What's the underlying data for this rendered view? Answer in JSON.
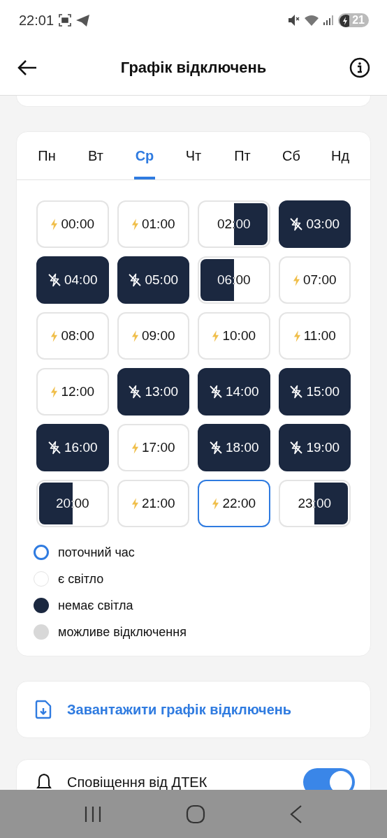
{
  "status_bar": {
    "time": "22:01",
    "battery": "21"
  },
  "app_bar": {
    "title": "Графік відключень"
  },
  "days": [
    {
      "label": "Пн",
      "selected": false
    },
    {
      "label": "Вт",
      "selected": false
    },
    {
      "label": "Ср",
      "selected": true
    },
    {
      "label": "Чт",
      "selected": false
    },
    {
      "label": "Пт",
      "selected": false
    },
    {
      "label": "Сб",
      "selected": false
    },
    {
      "label": "Нд",
      "selected": false
    }
  ],
  "hours": [
    {
      "time": "00:00",
      "kind": "on",
      "current": false
    },
    {
      "time": "01:00",
      "kind": "on",
      "current": false
    },
    {
      "time": "02:00",
      "kind": "late",
      "current": false
    },
    {
      "time": "03:00",
      "kind": "off",
      "current": false
    },
    {
      "time": "04:00",
      "kind": "off",
      "current": false
    },
    {
      "time": "05:00",
      "kind": "off",
      "current": false
    },
    {
      "time": "06:00",
      "kind": "early",
      "current": false
    },
    {
      "time": "07:00",
      "kind": "on",
      "current": false
    },
    {
      "time": "08:00",
      "kind": "on",
      "current": false
    },
    {
      "time": "09:00",
      "kind": "on",
      "current": false
    },
    {
      "time": "10:00",
      "kind": "on",
      "current": false
    },
    {
      "time": "11:00",
      "kind": "on",
      "current": false
    },
    {
      "time": "12:00",
      "kind": "on",
      "current": false
    },
    {
      "time": "13:00",
      "kind": "off",
      "current": false
    },
    {
      "time": "14:00",
      "kind": "off",
      "current": false
    },
    {
      "time": "15:00",
      "kind": "off",
      "current": false
    },
    {
      "time": "16:00",
      "kind": "off",
      "current": false
    },
    {
      "time": "17:00",
      "kind": "on",
      "current": false
    },
    {
      "time": "18:00",
      "kind": "off",
      "current": false
    },
    {
      "time": "19:00",
      "kind": "off",
      "current": false
    },
    {
      "time": "20:00",
      "kind": "early",
      "current": false
    },
    {
      "time": "21:00",
      "kind": "on",
      "current": false
    },
    {
      "time": "22:00",
      "kind": "on",
      "current": true
    },
    {
      "time": "23:00",
      "kind": "late",
      "current": false
    }
  ],
  "legend": [
    {
      "kind": "current",
      "label": "поточний час"
    },
    {
      "kind": "on",
      "label": "є світло"
    },
    {
      "kind": "off",
      "label": "немає світла"
    },
    {
      "kind": "possible",
      "label": "можливе відключення"
    }
  ],
  "download": {
    "label": "Завантажити графік відключень"
  },
  "notifications": {
    "label": "Сповіщення від ДТЕК",
    "on": true
  }
}
